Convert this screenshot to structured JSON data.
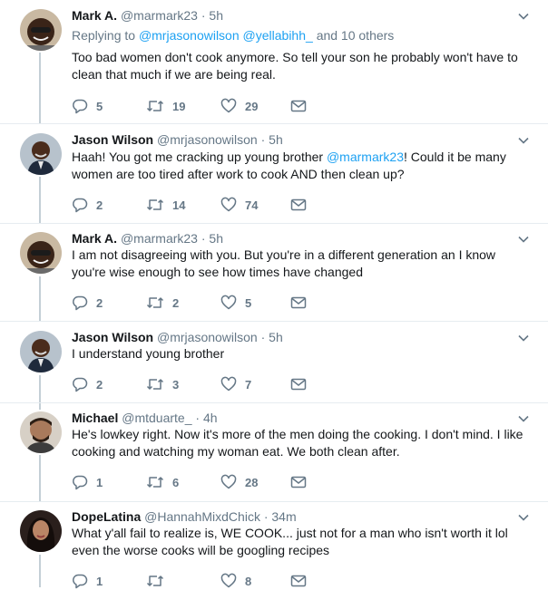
{
  "tweets": [
    {
      "name": "Mark A.",
      "handle": "@marmark23",
      "time": "· 5h",
      "reply_prefix": "Replying to",
      "reply_user1": "@mrjasonowilson",
      "reply_user2": "@yellabihh_",
      "reply_suffix": "and 10 others",
      "line1": "Too bad women don't cook anymore. So tell your son he probably won't have to",
      "line2": "clean that much if we are being real.",
      "replies": "5",
      "retweets": "19",
      "likes": "29"
    },
    {
      "name": "Jason Wilson",
      "handle": "@mrjasonowilson",
      "time": "· 5h",
      "line1_a": "Haah! You got me cracking up young brother ",
      "line1_mention": "@marmark23",
      "line1_b": "! Could it be many",
      "line2": "women are too tired after work to cook AND then clean up?",
      "replies": "2",
      "retweets": "14",
      "likes": "74"
    },
    {
      "name": "Mark A.",
      "handle": "@marmark23",
      "time": "· 5h",
      "line1": "I am not disagreeing with you. But you're in a different generation an I know",
      "line2": "you're wise enough to see how times have changed",
      "replies": "2",
      "retweets": "2",
      "likes": "5"
    },
    {
      "name": "Jason Wilson",
      "handle": "@mrjasonowilson",
      "time": "· 5h",
      "line1": "I understand young brother",
      "replies": "2",
      "retweets": "3",
      "likes": "7"
    },
    {
      "name": "Michael",
      "handle": "@mtduarte_",
      "time": "· 4h",
      "line1": "He's lowkey right. Now it's more of the men doing the cooking. I don't mind. I like",
      "line2": "cooking and watching my woman eat. We both clean after.",
      "replies": "1",
      "retweets": "6",
      "likes": "28"
    },
    {
      "name": "DopeLatina",
      "handle": "@HannahMixdChick",
      "time": "· 34m",
      "line1": "What y'all fail to realize is, WE COOK... just not for a man who isn't worth it lol",
      "line2": "even the worse cooks will be googling recipes",
      "replies": "1",
      "retweets": "",
      "likes": "8"
    }
  ],
  "icons": {
    "reply": "reply-icon",
    "retweet": "retweet-icon",
    "like": "heart-icon",
    "message": "envelope-icon",
    "menu": "chevron-down-icon"
  },
  "colors": {
    "link": "#1da1f2",
    "secondary": "#657786",
    "thread_line": "#c4cfd6"
  }
}
